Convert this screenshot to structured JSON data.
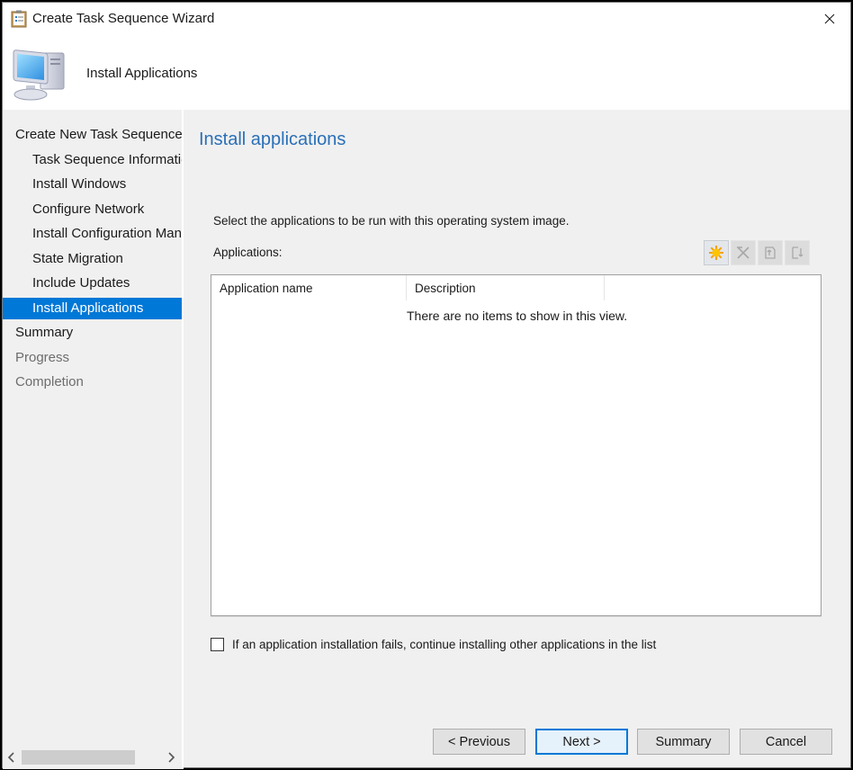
{
  "window": {
    "title": "Create Task Sequence Wizard",
    "icons": {
      "title": "wizard-clipboard-icon",
      "close": "close-icon"
    }
  },
  "header": {
    "title": "Install Applications",
    "icon": "computer-icon"
  },
  "sidebar": {
    "items": [
      {
        "label": "Create New Task Sequence",
        "level": 0,
        "state": "normal"
      },
      {
        "label": "Task Sequence Information",
        "level": 1,
        "state": "normal"
      },
      {
        "label": "Install Windows",
        "level": 1,
        "state": "normal"
      },
      {
        "label": "Configure Network",
        "level": 1,
        "state": "normal"
      },
      {
        "label": "Install Configuration Manager",
        "level": 1,
        "state": "normal"
      },
      {
        "label": "State Migration",
        "level": 1,
        "state": "normal"
      },
      {
        "label": "Include Updates",
        "level": 1,
        "state": "normal"
      },
      {
        "label": "Install Applications",
        "level": 1,
        "state": "active"
      },
      {
        "label": "Summary",
        "level": 0,
        "state": "normal"
      },
      {
        "label": "Progress",
        "level": 0,
        "state": "disabled"
      },
      {
        "label": "Completion",
        "level": 0,
        "state": "disabled"
      }
    ],
    "scrollbar": {
      "left_arrow": "chevron-left-icon",
      "right_arrow": "chevron-right-icon"
    }
  },
  "main": {
    "heading": "Install applications",
    "instructions": "Select the applications to be run with this operating system image.",
    "applications_label": "Applications:",
    "toolbar": [
      {
        "name": "new-icon",
        "enabled": true
      },
      {
        "name": "delete-icon",
        "enabled": false
      },
      {
        "name": "move-up-icon",
        "enabled": false
      },
      {
        "name": "move-down-icon",
        "enabled": false
      }
    ],
    "list": {
      "columns": [
        "Application name",
        "Description"
      ],
      "rows": [],
      "empty_message": "There are no items to show in this view."
    },
    "continue_on_failure": {
      "label": "If an application installation fails, continue installing other applications in the list",
      "checked": false
    }
  },
  "footer": {
    "previous": "< Previous",
    "next": "Next >",
    "summary": "Summary",
    "cancel": "Cancel"
  }
}
